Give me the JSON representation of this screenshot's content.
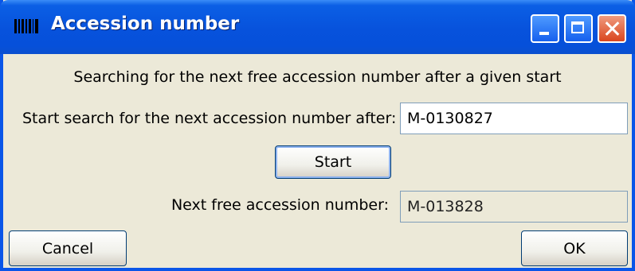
{
  "window": {
    "title": "Accession number",
    "title_icon": "barcode-icon"
  },
  "titlebar_buttons": {
    "minimize": "minimize-icon",
    "maximize": "maximize-icon",
    "close": "close-icon"
  },
  "colors": {
    "titlebar": "#0752dc",
    "dialog_background": "#ece9d8",
    "close_button": "#d9461f"
  },
  "dialog": {
    "heading": "Searching for the next free accession number after a given start",
    "start_label": "Start search for the next accession number after:",
    "start_value": "M-0130827",
    "start_button": "Start",
    "result_label": "Next free accession number:",
    "result_value": "M-013828"
  },
  "footer": {
    "cancel_label": "Cancel",
    "ok_label": "OK"
  }
}
